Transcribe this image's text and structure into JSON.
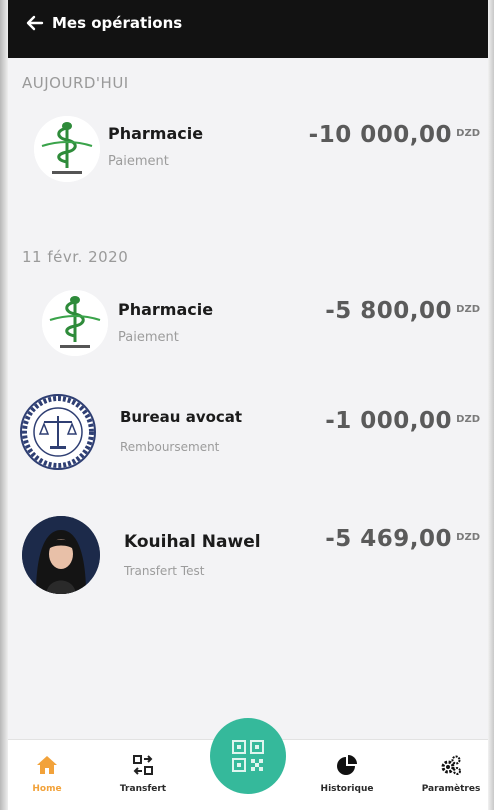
{
  "header": {
    "title": "Mes opérations"
  },
  "sections": [
    {
      "label": "AUJOURD'HUI",
      "items": [
        {
          "title": "Pharmacie",
          "subtitle": "Paiement",
          "amount": "-10 000,00",
          "currency": "DZD",
          "icon": "pharmacy-logo"
        }
      ]
    },
    {
      "label": "11 févr. 2020",
      "items": [
        {
          "title": "Pharmacie",
          "subtitle": "Paiement",
          "amount": "-5 800,00",
          "currency": "DZD",
          "icon": "pharmacy-logo"
        },
        {
          "title": "Bureau avocat",
          "subtitle": "Remboursement",
          "amount": "-1 000,00",
          "currency": "DZD",
          "icon": "lawyer-seal-logo"
        },
        {
          "title": "Kouihal Nawel",
          "subtitle": "Transfert Test",
          "amount": "-5 469,00",
          "currency": "DZD",
          "icon": "user-avatar"
        }
      ]
    }
  ],
  "nav": {
    "items": [
      {
        "label": "Home",
        "icon": "home-icon",
        "active": true
      },
      {
        "label": "Transfert",
        "icon": "transfer-icon",
        "active": false
      },
      {
        "label": "Historique",
        "icon": "pie-chart-icon",
        "active": false
      },
      {
        "label": "Paramètres",
        "icon": "settings-gears-icon",
        "active": false
      }
    ],
    "center_icon": "qr-code-icon"
  },
  "colors": {
    "header_bg": "#121212",
    "accent_home": "#f2a23a",
    "qr_fab": "#35b99b",
    "pharmacy_green": "#2e8b3a"
  }
}
